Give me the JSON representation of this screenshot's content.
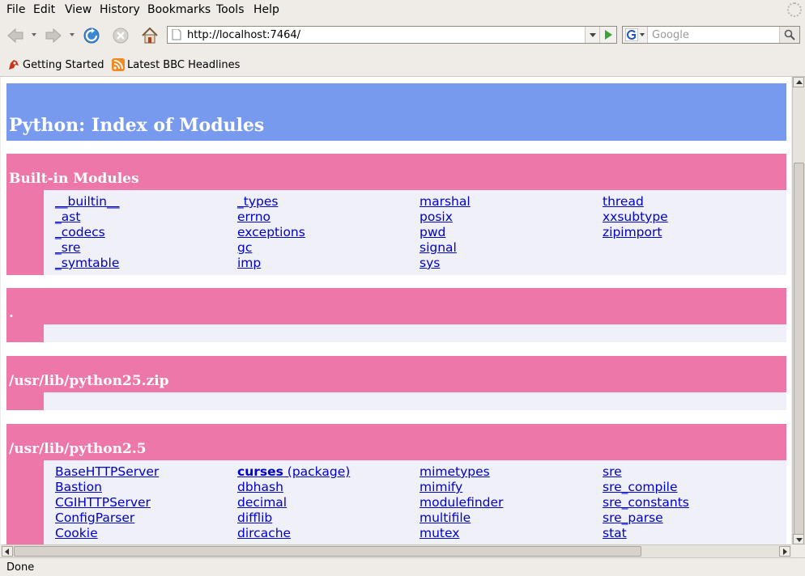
{
  "menubar": {
    "items": [
      "File",
      "Edit",
      "View",
      "History",
      "Bookmarks",
      "Tools",
      "Help"
    ]
  },
  "navbar": {
    "url": "http://localhost:7464/",
    "search_placeholder": "Google"
  },
  "bookmarks": {
    "items": [
      "Getting Started",
      "Latest BBC Headlines"
    ]
  },
  "page": {
    "title": "Python: Index of Modules",
    "sections": {
      "builtin": {
        "title": "Built-in Modules",
        "cols": [
          [
            "__builtin__",
            "_ast",
            "_codecs",
            "_sre",
            "_symtable"
          ],
          [
            "_types",
            "errno",
            "exceptions",
            "gc",
            "imp"
          ],
          [
            "marshal",
            "posix",
            "pwd",
            "signal",
            "sys"
          ],
          [
            "thread",
            "xxsubtype",
            "zipimport"
          ]
        ]
      },
      "dot": {
        "title": "."
      },
      "zip": {
        "title": "/usr/lib/python25.zip"
      },
      "py25": {
        "title": "/usr/lib/python2.5",
        "cols": [
          [
            "BaseHTTPServer",
            "Bastion",
            "CGIHTTPServer",
            "ConfigParser",
            "Cookie"
          ],
          [
            "curses",
            "dbhash",
            "decimal",
            "difflib",
            "dircache"
          ],
          [
            "mimetypes",
            "mimify",
            "modulefinder",
            "multifile",
            "mutex"
          ],
          [
            "sre",
            "sre_compile",
            "sre_constants",
            "sre_parse",
            "stat"
          ]
        ],
        "package_suffix": "(package)"
      }
    }
  },
  "status": {
    "text": "Done"
  },
  "colors": {
    "heading": "#7799ee",
    "section": "#ee77aa",
    "body_bg": "#f0f0f8",
    "link": "#0000cc"
  }
}
